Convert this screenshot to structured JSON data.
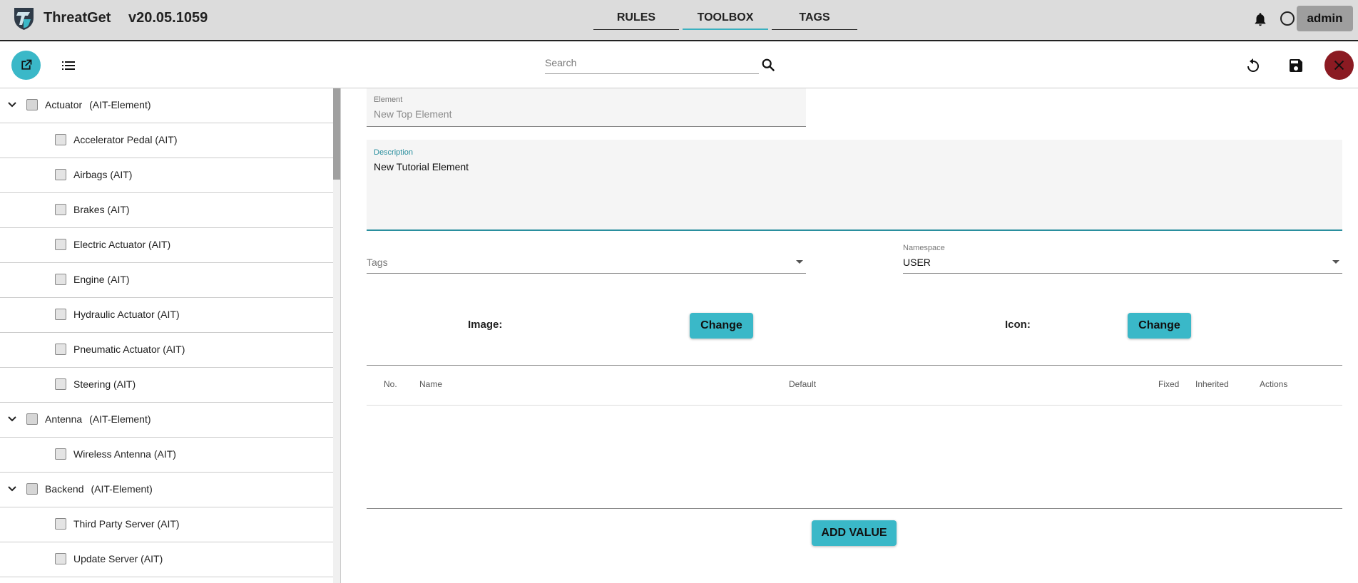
{
  "header": {
    "app_name": "ThreatGet",
    "version": "v20.05.1059",
    "tabs": [
      {
        "label": "RULES"
      },
      {
        "label": "TOOLBOX"
      },
      {
        "label": "TAGS"
      }
    ],
    "user_label": "admin",
    "icons": {
      "logo": "threatget-logo",
      "notifications": "bell-icon",
      "status": "circle-icon"
    }
  },
  "toolbar": {
    "search_placeholder": "Search",
    "icons": {
      "open": "open-in-new-icon",
      "list": "list-icon",
      "search": "search-icon",
      "reset": "undo-icon",
      "save": "save-icon",
      "close": "close-icon"
    }
  },
  "sidebar": {
    "items": [
      {
        "level": "parent",
        "label": "Actuator",
        "type": "(AIT-Element)",
        "expanded": true
      },
      {
        "level": "child",
        "label": "Accelerator Pedal (AIT)"
      },
      {
        "level": "child",
        "label": "Airbags (AIT)"
      },
      {
        "level": "child",
        "label": "Brakes (AIT)"
      },
      {
        "level": "child",
        "label": "Electric Actuator (AIT)"
      },
      {
        "level": "child",
        "label": "Engine (AIT)"
      },
      {
        "level": "child",
        "label": "Hydraulic Actuator (AIT)"
      },
      {
        "level": "child",
        "label": "Pneumatic Actuator (AIT)"
      },
      {
        "level": "child",
        "label": "Steering (AIT)"
      },
      {
        "level": "parent",
        "label": "Antenna",
        "type": "(AIT-Element)",
        "expanded": true
      },
      {
        "level": "child",
        "label": "Wireless Antenna (AIT)"
      },
      {
        "level": "parent",
        "label": "Backend",
        "type": "(AIT-Element)",
        "expanded": true
      },
      {
        "level": "child",
        "label": "Third Party Server (AIT)"
      },
      {
        "level": "child",
        "label": "Update Server (AIT)"
      }
    ]
  },
  "form": {
    "element": {
      "label": "Element",
      "value": "New Top Element"
    },
    "description": {
      "label": "Description",
      "value": "New Tutorial Element"
    },
    "tags": {
      "placeholder": "Tags"
    },
    "namespace": {
      "label": "Namespace",
      "value": "USER"
    },
    "image_label": "Image:",
    "icon_label": "Icon:",
    "change_label": "Change"
  },
  "values_table": {
    "columns": [
      "No.",
      "Name",
      "Default",
      "Fixed",
      "Inherited",
      "Actions"
    ],
    "rows": []
  },
  "add_value_label": "ADD VALUE",
  "colors": {
    "accent": "#3ab8c8",
    "accent_dark": "#2a8f9e",
    "close_button": "#8b1a22",
    "header_bg": "#dcdcdc"
  }
}
